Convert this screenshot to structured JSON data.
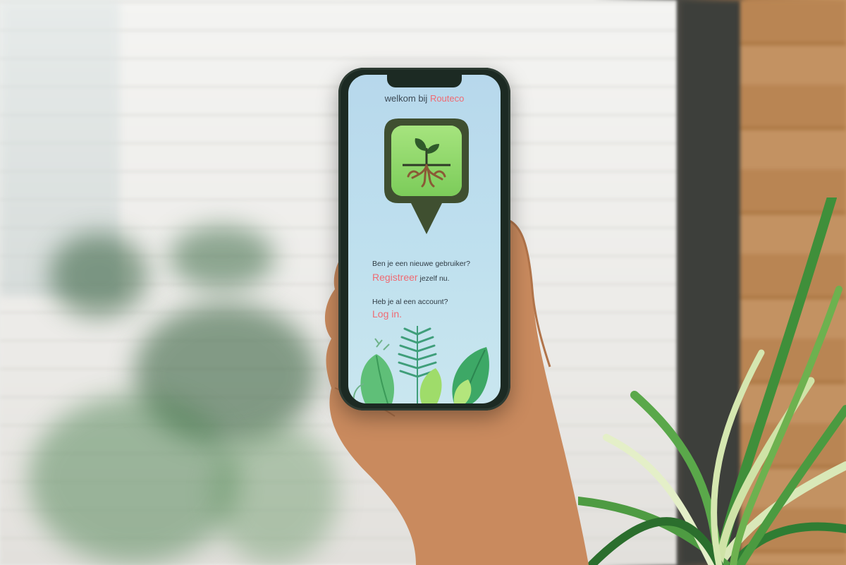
{
  "app": {
    "welcome_prefix": "welkom bij ",
    "brand_name": "Routeco",
    "brand_color": "#ef6b73"
  },
  "logo": {
    "icon": "seedling-roots-pin-icon"
  },
  "register": {
    "question": "Ben je een nieuwe gebruiker?",
    "link_label": "Registreer",
    "link_suffix": " jezelf nu."
  },
  "login": {
    "question": "Heb je al een account?",
    "link_label": "Log in."
  },
  "decoration": {
    "icon": "jungle-leaves-icon"
  }
}
